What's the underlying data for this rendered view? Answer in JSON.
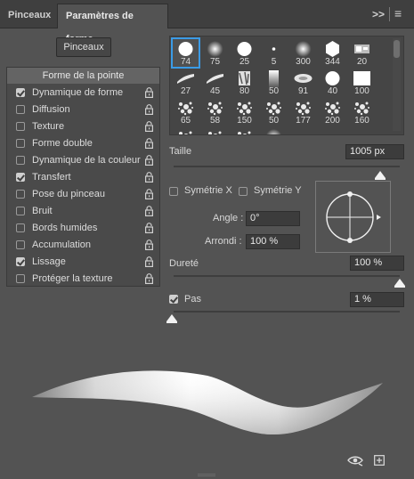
{
  "tabs": [
    {
      "label": "Pinceaux",
      "active": false
    },
    {
      "label": "Paramètres de forme",
      "active": true
    }
  ],
  "tabbar": {
    "expand_glyph": ">>",
    "menu_glyph": "≡"
  },
  "sidebar": {
    "brushes_button": "Pinceaux",
    "header": "Forme de la pointe",
    "options": [
      {
        "label": "Dynamique de forme",
        "checked": true
      },
      {
        "label": "Diffusion",
        "checked": false
      },
      {
        "label": "Texture",
        "checked": false
      },
      {
        "label": "Forme double",
        "checked": false
      },
      {
        "label": "Dynamique de la couleur",
        "checked": false
      },
      {
        "label": "Transfert",
        "checked": true
      },
      {
        "label": "Pose du pinceau",
        "checked": false
      },
      {
        "label": "Bruit",
        "checked": false
      },
      {
        "label": "Bords humides",
        "checked": false
      },
      {
        "label": "Accumulation",
        "checked": false
      },
      {
        "label": "Lissage",
        "checked": true
      },
      {
        "label": "Protéger la texture",
        "checked": false
      }
    ]
  },
  "brush_tips": [
    {
      "size": "74",
      "icon": "hard-round-icon",
      "selected": true
    },
    {
      "size": "75",
      "icon": "soft-round-icon"
    },
    {
      "size": "25",
      "icon": "hard-round-icon"
    },
    {
      "size": "5",
      "icon": "dot-icon"
    },
    {
      "size": "300",
      "icon": "soft-round-icon"
    },
    {
      "size": "344",
      "icon": "hexagon-icon"
    },
    {
      "size": "20",
      "icon": "stamp-icon"
    },
    {
      "size": "27",
      "icon": "streak-icon"
    },
    {
      "size": "45",
      "icon": "streak-icon"
    },
    {
      "size": "80",
      "icon": "grunge-icon"
    },
    {
      "size": "50",
      "icon": "fade-bar-icon"
    },
    {
      "size": "91",
      "icon": "smoke-icon"
    },
    {
      "size": "40",
      "icon": "hard-round-icon"
    },
    {
      "size": "100",
      "icon": "square-icon"
    },
    {
      "size": "65",
      "icon": "spatter-icon"
    },
    {
      "size": "58",
      "icon": "spatter-icon"
    },
    {
      "size": "150",
      "icon": "spatter-icon"
    },
    {
      "size": "50",
      "icon": "spatter-icon"
    },
    {
      "size": "177",
      "icon": "spatter-icon"
    },
    {
      "size": "200",
      "icon": "spatter-icon"
    },
    {
      "size": "160",
      "icon": "spatter-icon"
    },
    {
      "size": "",
      "icon": "spatter-icon"
    },
    {
      "size": "",
      "icon": "spatter-icon"
    },
    {
      "size": "",
      "icon": "spatter-icon"
    },
    {
      "size": "",
      "icon": "soft-round-icon"
    }
  ],
  "params": {
    "size_label": "Taille",
    "size_value": "1005 px",
    "size_slider": 0.92,
    "flip_x_label": "Symétrie X",
    "flip_x": false,
    "flip_y_label": "Symétrie Y",
    "flip_y": false,
    "angle_label": "Angle :",
    "angle_value": "0°",
    "roundness_label": "Arrondi :",
    "roundness_value": "100 %",
    "hardness_label": "Dureté",
    "hardness_value": "100 %",
    "hardness_slider": 1.0,
    "spacing_label": "Pas",
    "spacing_checked": true,
    "spacing_value": "1 %",
    "spacing_slider": 0.0
  },
  "colors": {
    "accent": "#3b9be6",
    "panel": "#535353",
    "tabbar": "#3f3f3f"
  }
}
